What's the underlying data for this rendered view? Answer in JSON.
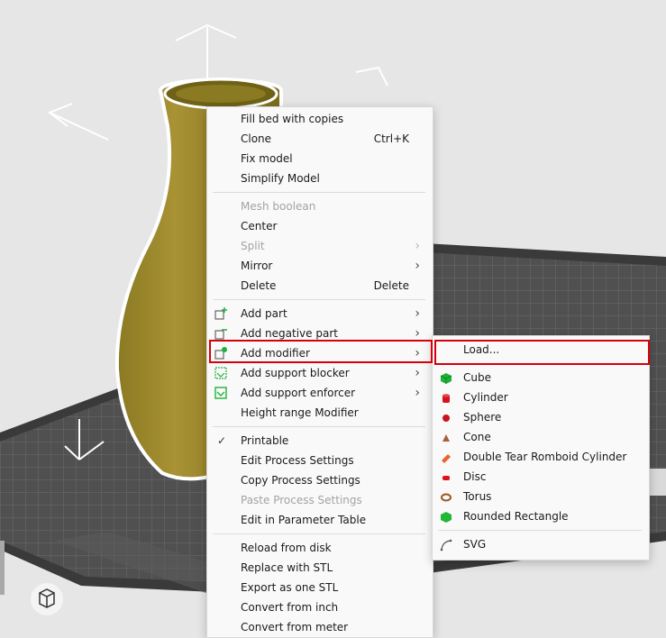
{
  "context_menu": {
    "groups": [
      [
        {
          "label": "Fill bed with copies"
        },
        {
          "label": "Clone",
          "shortcut": "Ctrl+K"
        },
        {
          "label": "Fix model"
        },
        {
          "label": "Simplify Model"
        }
      ],
      [
        {
          "label": "Mesh boolean",
          "disabled": true
        },
        {
          "label": "Center"
        },
        {
          "label": "Split",
          "disabled": true,
          "submenu": true
        },
        {
          "label": "Mirror",
          "submenu": true
        },
        {
          "label": "Delete",
          "shortcut": "Delete"
        }
      ],
      [
        {
          "label": "Add part",
          "submenu": true,
          "icon": "add-part-icon"
        },
        {
          "label": "Add negative part",
          "submenu": true,
          "icon": "add-negative-part-icon"
        },
        {
          "label": "Add modifier",
          "submenu": true,
          "icon": "add-modifier-icon",
          "highlighted": true
        },
        {
          "label": "Add support blocker",
          "submenu": true,
          "icon": "support-blocker-icon"
        },
        {
          "label": "Add support enforcer",
          "submenu": true,
          "icon": "support-enforcer-icon"
        },
        {
          "label": "Height range Modifier"
        }
      ],
      [
        {
          "label": "Printable",
          "checked": true
        },
        {
          "label": "Edit Process Settings"
        },
        {
          "label": "Copy Process Settings"
        },
        {
          "label": "Paste Process Settings",
          "disabled": true
        },
        {
          "label": "Edit in Parameter Table"
        }
      ],
      [
        {
          "label": "Reload from disk"
        },
        {
          "label": "Replace with STL"
        },
        {
          "label": "Export as one STL"
        },
        {
          "label": "Convert from inch"
        },
        {
          "label": "Convert from meter"
        }
      ]
    ]
  },
  "submenu": {
    "groups": [
      [
        {
          "label": "Load...",
          "highlighted": true
        }
      ],
      [
        {
          "label": "Cube",
          "icon": "cube-icon",
          "color": "#1fb23a"
        },
        {
          "label": "Cylinder",
          "icon": "cylinder-icon",
          "color": "#d4141c"
        },
        {
          "label": "Sphere",
          "icon": "sphere-icon",
          "color": "#c8141c"
        },
        {
          "label": "Cone",
          "icon": "cone-icon",
          "color": "#a8603a"
        },
        {
          "label": "Double Tear Romboid Cylinder",
          "icon": "double-tear-romboid-cylinder-icon",
          "color": "#e8652a"
        },
        {
          "label": "Disc",
          "icon": "disc-icon",
          "color": "#e0101c"
        },
        {
          "label": "Torus",
          "icon": "torus-icon",
          "color": "#a0541c"
        },
        {
          "label": "Rounded Rectangle",
          "icon": "rounded-rectangle-icon",
          "color": "#20b838"
        }
      ],
      [
        {
          "label": "SVG",
          "icon": "svg-curve-icon",
          "color": "#555555"
        }
      ]
    ]
  },
  "scene": {
    "model_color": "#9c8a2e",
    "bed_color": "#4a4a4a",
    "background_color": "#e6e6e6",
    "highlight_color": "#d6000c",
    "view_cube_icon": "view-cube-icon"
  }
}
